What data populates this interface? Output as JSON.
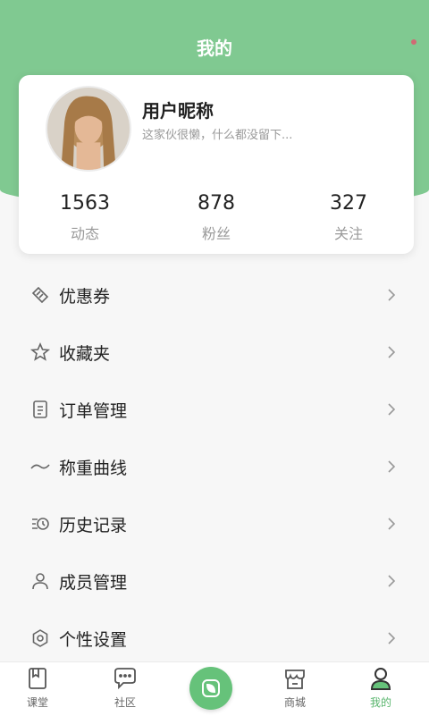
{
  "header": {
    "title": "我的"
  },
  "profile": {
    "nickname": "用户昵称",
    "bio": "这家伙很懒，什么都没留下...",
    "stats": [
      {
        "value": "1563",
        "label": "动态"
      },
      {
        "value": "878",
        "label": "粉丝"
      },
      {
        "value": "327",
        "label": "关注"
      }
    ]
  },
  "menu": [
    {
      "label": "优惠券",
      "icon": "coupon-icon"
    },
    {
      "label": "收藏夹",
      "icon": "star-icon"
    },
    {
      "label": "订单管理",
      "icon": "order-icon"
    },
    {
      "label": "称重曲线",
      "icon": "curve-icon"
    },
    {
      "label": "历史记录",
      "icon": "history-icon"
    },
    {
      "label": "成员管理",
      "icon": "member-icon"
    },
    {
      "label": "个性设置",
      "icon": "settings-icon"
    }
  ],
  "tabbar": {
    "items": [
      {
        "label": "课堂",
        "icon": "book-icon"
      },
      {
        "label": "社区",
        "icon": "chat-icon"
      },
      {
        "label": "商城",
        "icon": "store-icon"
      },
      {
        "label": "我的",
        "icon": "user-icon",
        "active": true
      }
    ],
    "center_icon": "leaf-icon"
  },
  "colors": {
    "accent": "#80c991",
    "tab_active": "#59b56d"
  }
}
